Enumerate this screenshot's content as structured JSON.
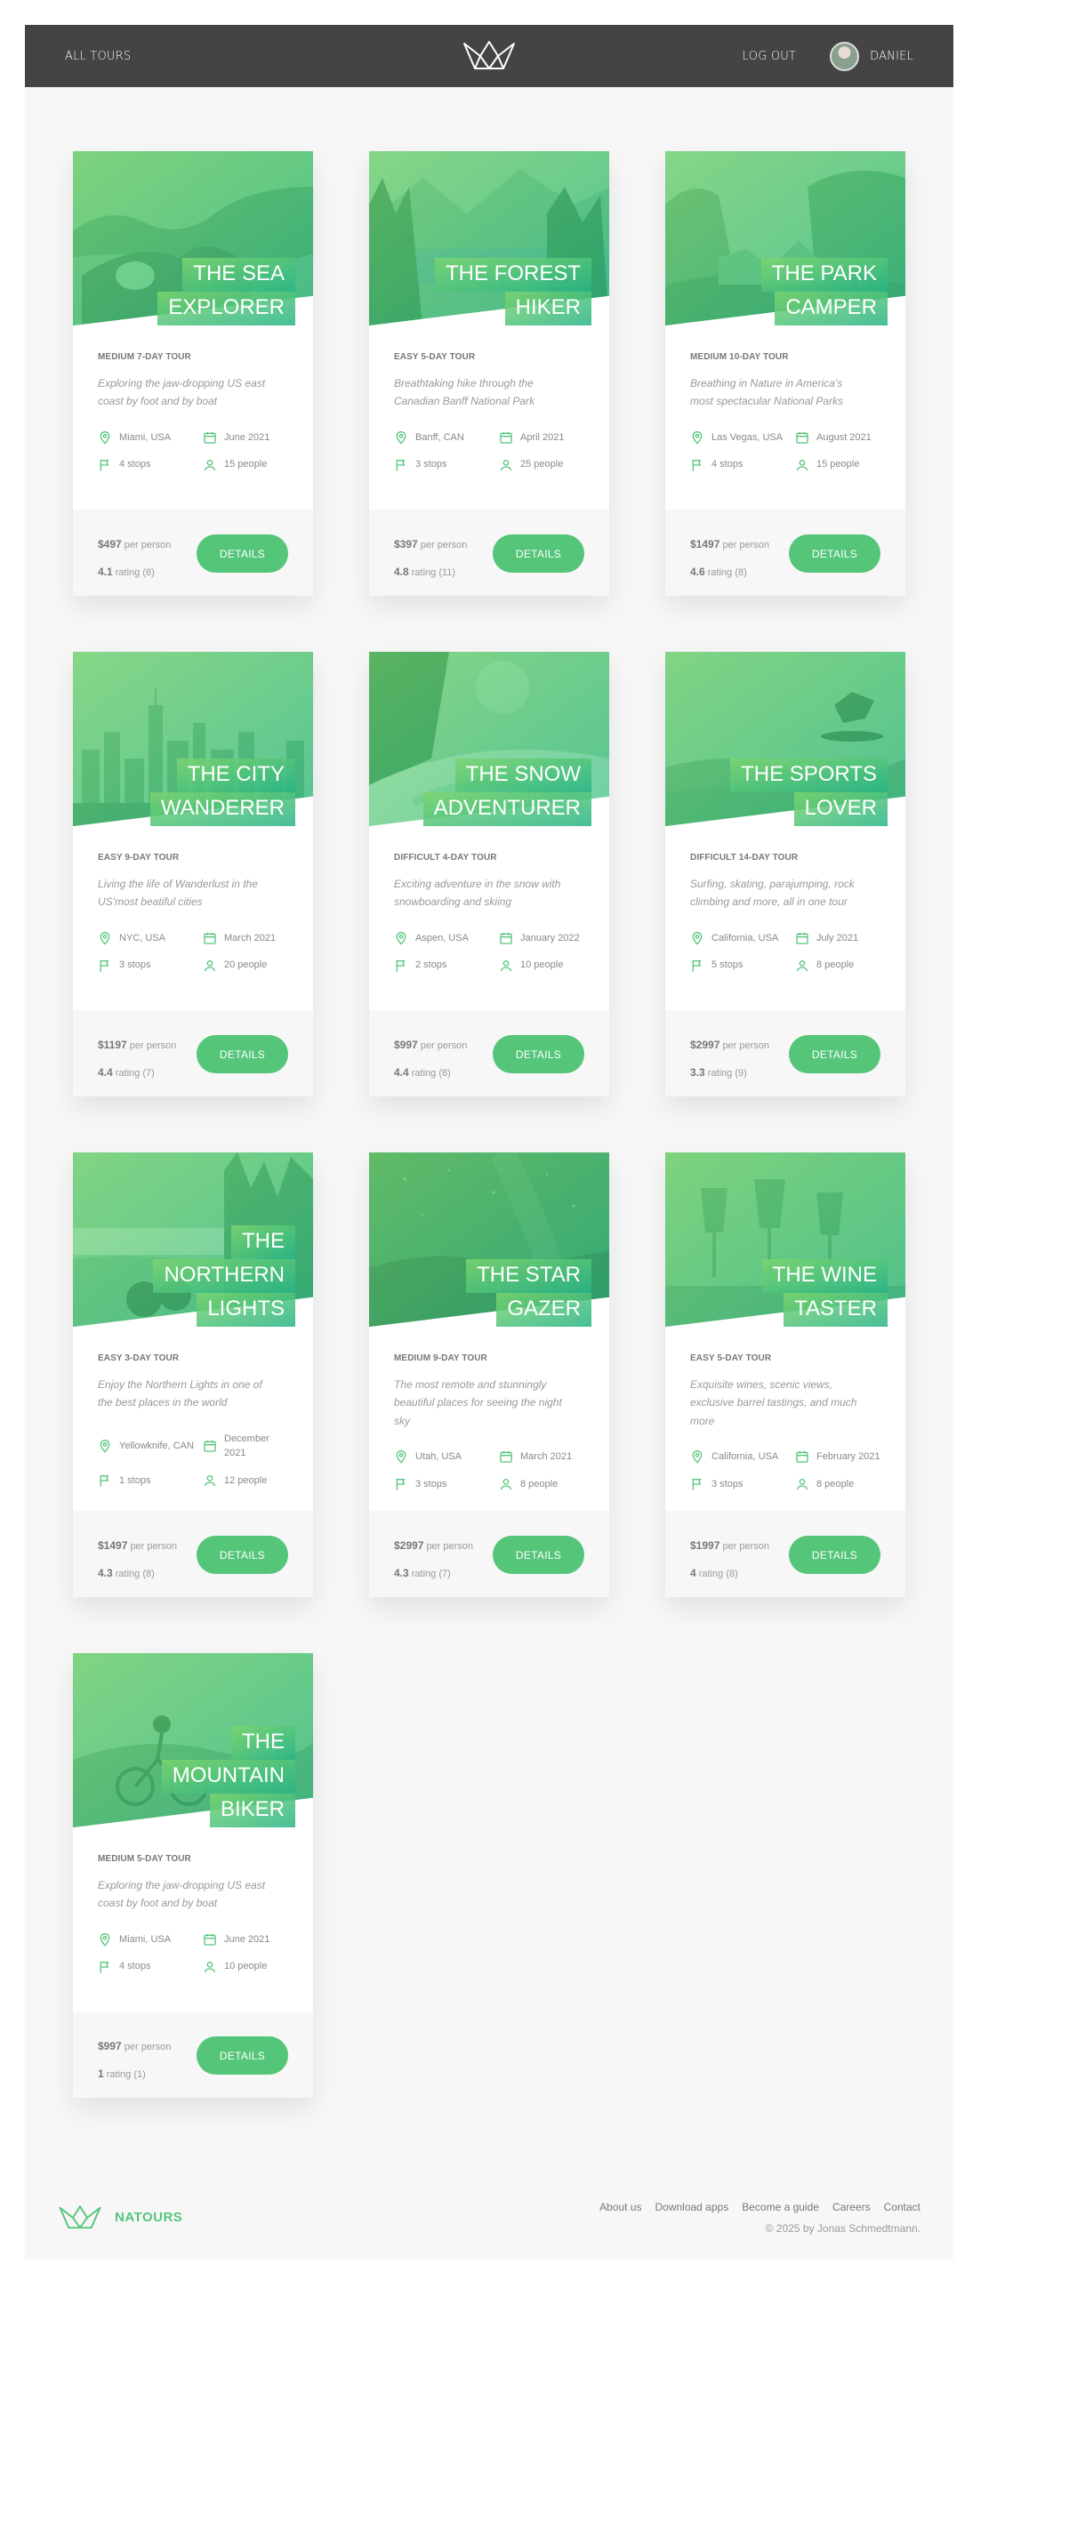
{
  "header": {
    "all_tours": "All tours",
    "logout": "Log out",
    "user_name": "Daniel"
  },
  "tours": [
    {
      "title_lines": [
        "The Sea",
        "Explorer"
      ],
      "subtitle": "Medium 7-day tour",
      "summary": "Exploring the jaw-dropping US east coast by foot and by boat",
      "location": "Miami, USA",
      "date": "June 2021",
      "stops": "4 stops",
      "people": "15 people",
      "price": "$497",
      "price_unit": "per person",
      "rating": "4.1",
      "rating_label": "rating (8)",
      "button": "Details",
      "scene": "sea"
    },
    {
      "title_lines": [
        "The Forest",
        "Hiker"
      ],
      "subtitle": "Easy 5-day tour",
      "summary": "Breathtaking hike through the Canadian Banff National Park",
      "location": "Banff, CAN",
      "date": "April 2021",
      "stops": "3 stops",
      "people": "25 people",
      "price": "$397",
      "price_unit": "per person",
      "rating": "4.8",
      "rating_label": "rating (11)",
      "button": "Details",
      "scene": "forest"
    },
    {
      "title_lines": [
        "The Park",
        "Camper"
      ],
      "subtitle": "Medium 10-day tour",
      "summary": "Breathing in Nature in America's most spectacular National Parks",
      "location": "Las Vegas, USA",
      "date": "August 2021",
      "stops": "4 stops",
      "people": "15 people",
      "price": "$1497",
      "price_unit": "per person",
      "rating": "4.6",
      "rating_label": "rating (8)",
      "button": "Details",
      "scene": "park"
    },
    {
      "title_lines": [
        "The City",
        "Wanderer"
      ],
      "subtitle": "Easy 9-day tour",
      "summary": "Living the life of Wanderlust in the US'most beatiful cities",
      "location": "NYC, USA",
      "date": "March 2021",
      "stops": "3 stops",
      "people": "20 people",
      "price": "$1197",
      "price_unit": "per person",
      "rating": "4.4",
      "rating_label": "rating (7)",
      "button": "Details",
      "scene": "city"
    },
    {
      "title_lines": [
        "The Snow",
        "Adventurer"
      ],
      "subtitle": "Difficult 4-day tour",
      "summary": "Exciting adventure in the snow with snowboarding and skiing",
      "location": "Aspen, USA",
      "date": "January 2022",
      "stops": "2 stops",
      "people": "10 people",
      "price": "$997",
      "price_unit": "per person",
      "rating": "4.4",
      "rating_label": "rating (8)",
      "button": "Details",
      "scene": "snow"
    },
    {
      "title_lines": [
        "The Sports",
        "Lover"
      ],
      "subtitle": "Difficult 14-day tour",
      "summary": "Surfing, skating, parajumping, rock climbing and more, all in one tour",
      "location": "California, USA",
      "date": "July 2021",
      "stops": "5 stops",
      "people": "8 people",
      "price": "$2997",
      "price_unit": "per person",
      "rating": "3.3",
      "rating_label": "rating (9)",
      "button": "Details",
      "scene": "sports"
    },
    {
      "title_lines": [
        "The",
        "Northern",
        "Lights"
      ],
      "subtitle": "Easy 3-day tour",
      "summary": "Enjoy the Northern Lights in one of the best places in the world",
      "location": "Yellowknife, CAN",
      "date": "December 2021",
      "stops": "1 stops",
      "people": "12 people",
      "price": "$1497",
      "price_unit": "per person",
      "rating": "4.3",
      "rating_label": "rating (8)",
      "button": "Details",
      "scene": "northern"
    },
    {
      "title_lines": [
        "The Star",
        "Gazer"
      ],
      "subtitle": "Medium 9-day tour",
      "summary": "The most remote and stunningly beautiful places for seeing the night sky",
      "location": "Utah, USA",
      "date": "March 2021",
      "stops": "3 stops",
      "people": "8 people",
      "price": "$2997",
      "price_unit": "per person",
      "rating": "4.3",
      "rating_label": "rating (7)",
      "button": "Details",
      "scene": "star"
    },
    {
      "title_lines": [
        "The Wine",
        "Taster"
      ],
      "subtitle": "Easy 5-day tour",
      "summary": "Exquisite wines, scenic views, exclusive barrel tastings, and much more",
      "location": "California, USA",
      "date": "February 2021",
      "stops": "3 stops",
      "people": "8 people",
      "price": "$1997",
      "price_unit": "per person",
      "rating": "4",
      "rating_label": "rating (8)",
      "button": "Details",
      "scene": "wine"
    },
    {
      "title_lines": [
        "The",
        "Mountain",
        "Biker"
      ],
      "subtitle": "Medium 5-day tour",
      "summary": "Exploring the jaw-dropping US east coast by foot and by boat",
      "location": "Miami, USA",
      "date": "June 2021",
      "stops": "4 stops",
      "people": "10 people",
      "price": "$997",
      "price_unit": "per person",
      "rating": "1",
      "rating_label": "rating (1)",
      "button": "Details",
      "scene": "biker"
    }
  ],
  "footer": {
    "brand": "NATOURS",
    "links": [
      "About us",
      "Download apps",
      "Become a guide",
      "Careers",
      "Contact"
    ],
    "copyright": "© 2025 by Jonas Schmedtmann."
  },
  "colors": {
    "primary": "#55c57a",
    "primary_dark": "#28b485",
    "header_bg": "#444444",
    "page_bg": "#f7f7f7"
  }
}
